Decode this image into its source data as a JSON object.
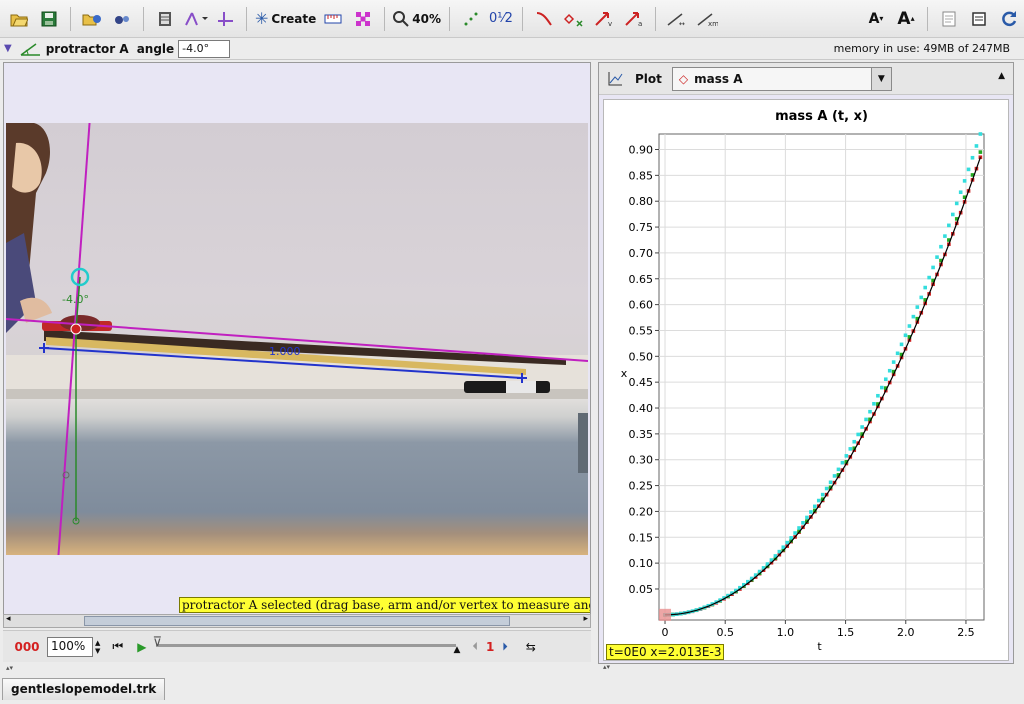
{
  "toolbar": {
    "create_label": "Create",
    "zoom_label": "40%",
    "icons": [
      "open-icon",
      "save-icon",
      "open-video-icon",
      "clip-settings-icon",
      "coordinate-axes-icon",
      "calibration-tools-icon",
      "create-track-icon",
      "ruler-icon",
      "zoom-icon",
      "track-points-icon",
      "step-counter-icon",
      "path-icon",
      "mark-icon",
      "velocity-icon",
      "acceleration-icon",
      "trails-icon",
      "tape-measure-icon",
      "font-smaller-icon",
      "font-larger-icon",
      "notes-icon",
      "properties-icon",
      "refresh-icon"
    ],
    "counter_label": "0¹⁄2"
  },
  "propbar": {
    "track_name": "protractor A",
    "angle_label": "angle",
    "angle_value": "-4.0°",
    "memory": "memory in use: 49MB of 247MB"
  },
  "video": {
    "protractor_angle": "-4.0°",
    "tape_length": "1.000",
    "status_message": "protractor A selected (drag base, arm and/or vertex to measure angles)"
  },
  "player": {
    "frame_counter": "000",
    "rate": "100%",
    "step_size": "1"
  },
  "plot": {
    "plot_button": "Plot",
    "track": "mass A",
    "title": "mass A (t, x)",
    "xlabel": "t",
    "ylabel": "x",
    "readout": "t=0E0  x=2.013E-3"
  },
  "file_tab": "gentleslopemodel.trk",
  "chart_data": {
    "type": "scatter",
    "title": "mass A (t, x)",
    "xlabel": "t",
    "ylabel": "x",
    "xlim": [
      -0.05,
      2.65
    ],
    "ylim": [
      -0.01,
      0.93
    ],
    "x_ticks": [
      "0",
      "0.5",
      "1.0",
      "1.5",
      "2.0",
      "2.5"
    ],
    "y_ticks": [
      "0.05",
      "0.10",
      "0.15",
      "0.20",
      "0.25",
      "0.30",
      "0.35",
      "0.40",
      "0.45",
      "0.50",
      "0.55",
      "0.60",
      "0.65",
      "0.70",
      "0.75",
      "0.80",
      "0.85",
      "0.90"
    ],
    "grid": true,
    "series": [
      {
        "color": "#cc2020",
        "t_max": 2.62,
        "x_max": 0.885,
        "points": 80,
        "style": "points"
      },
      {
        "color": "#22aa22",
        "t_max": 2.62,
        "x_max": 0.895,
        "points": 40,
        "style": "points"
      },
      {
        "color": "#33dddd",
        "t_max": 2.62,
        "x_max": 0.93,
        "points": 80,
        "style": "points"
      },
      {
        "color": "#000000",
        "t_max": 2.62,
        "x_max": 0.885,
        "style": "line"
      }
    ]
  }
}
